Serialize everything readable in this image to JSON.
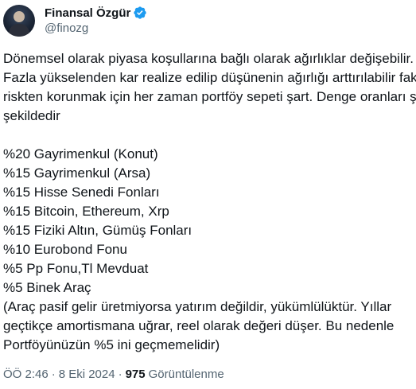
{
  "author": {
    "display_name": "Finansal Özgür",
    "handle": "@finozg",
    "verified": true,
    "verified_color": "#1d9bf0"
  },
  "tweet": {
    "lines": [
      "Dönemsel olarak piyasa koşullarına bağlı olarak ağırlıklar değişebilir.",
      "Fazla yükselenden kar realize edilip düşünenin ağırlığı arttırılabilir fakat",
      "riskten korunmak için her zaman portföy sepeti şart. Denge oranları şu",
      "şekildedir",
      "",
      "%20 Gayrimenkul (Konut)",
      "%15 Gayrimenkul (Arsa)",
      "%15 Hisse Senedi Fonları",
      "%15 Bitcoin, Ethereum, Xrp",
      "%15 Fiziki Altın, Gümüş Fonları",
      "%10 Eurobond Fonu",
      "%5 Pp Fonu,Tl Mevduat",
      "%5 Binek Araç",
      "(Araç pasif gelir üretmiyorsa yatırım değildir, yükümlülüktür. Yıllar",
      "geçtikçe amortismana uğrar, reel olarak değeri düşer. Bu nedenle",
      "Portföyünüzün %5 ini geçmemelidir)"
    ]
  },
  "meta": {
    "time": "ÖÖ 2:46",
    "separator": "·",
    "date": "8 Eki 2024",
    "views_count": "975",
    "views_label": "Görüntülenme"
  }
}
